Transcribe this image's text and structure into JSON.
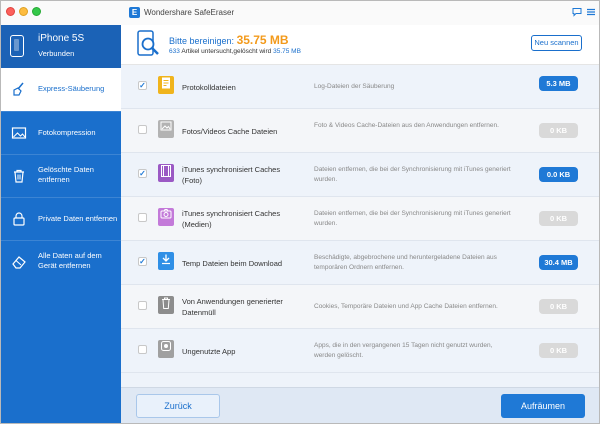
{
  "window": {
    "title": "Wondershare SafeEraser",
    "logo_letter": "E"
  },
  "device": {
    "name": "iPhone 5S",
    "status": "Verbunden"
  },
  "sidebar": {
    "items": [
      {
        "label": "Express-Säuberung",
        "icon": "broom-icon",
        "active": true
      },
      {
        "label": "Fotokompression",
        "icon": "photo-icon",
        "active": false
      },
      {
        "label": "Gelöschte Daten entfernen",
        "icon": "trash-icon",
        "active": false
      },
      {
        "label": "Private Daten entfernen",
        "icon": "lock-icon",
        "active": false
      },
      {
        "label": "Alle Daten auf dem Gerät entfernen",
        "icon": "eraser-icon",
        "active": false
      }
    ]
  },
  "summary": {
    "heading_prefix": "Bitte bereinigen:",
    "amount": "35.75 MB",
    "count": "633",
    "sub_text": "Artikel untersucht,gelöscht wird",
    "sub_amount": "35.75 MB",
    "rescan_label": "Neu scannen"
  },
  "rows": [
    {
      "title": "Protokolldateien",
      "desc": "Log-Dateien der Säuberung",
      "size": "5.3 MB",
      "checked": true,
      "icon": "log-file-icon",
      "icon_color": "#f0b41c"
    },
    {
      "title": "Fotos/Videos Cache Dateien",
      "desc": "Foto & Videos Cache-Dateien aus den Anwendungen entfernen.",
      "size": "0 KB",
      "checked": false,
      "icon": "photo-cache-icon",
      "icon_color": "#b3b3b3"
    },
    {
      "title": "iTunes synchronisiert Caches (Foto)",
      "desc": "Dateien entfernen, die bei der Synchronisierung mit iTunes generiert wurden.",
      "size": "0.0 KB",
      "checked": true,
      "icon": "film-icon",
      "icon_color": "#9b59c4"
    },
    {
      "title": "iTunes synchronisiert Caches (Medien)",
      "desc": "Dateien entfernen, die bei der Synchronisierung mit iTunes generiert wurden.",
      "size": "0 KB",
      "checked": false,
      "icon": "camera-icon",
      "icon_color": "#c37ad9"
    },
    {
      "title": "Temp Dateien beim Download",
      "desc": "Beschädigte, abgebrochene und heruntergeladene Dateien aus temporären Ordnern entfernen.",
      "size": "30.4 MB",
      "checked": true,
      "icon": "download-icon",
      "icon_color": "#2f8fe6"
    },
    {
      "title": "Von Anwendungen generierter Datenmüll",
      "desc": "Cookies, Temporäre Dateien und App Cache Dateien entfernen.",
      "size": "0 KB",
      "checked": false,
      "icon": "trash-icon",
      "icon_color": "#8d8d8d"
    },
    {
      "title": "Ungenutzte App",
      "desc": "Apps, die in den vergangenen 15 Tagen nicht genutzt wurden, werden gelöscht.",
      "size": "0 KB",
      "checked": false,
      "icon": "app-icon",
      "icon_color": "#a0a0a0"
    }
  ],
  "footer": {
    "back_label": "Zurück",
    "clean_label": "Aufräumen"
  },
  "colors": {
    "accent": "#1a6fcc",
    "amount": "#f39a1b",
    "badge_active": "#1f79d6",
    "badge_inactive": "#d9d9d9"
  }
}
